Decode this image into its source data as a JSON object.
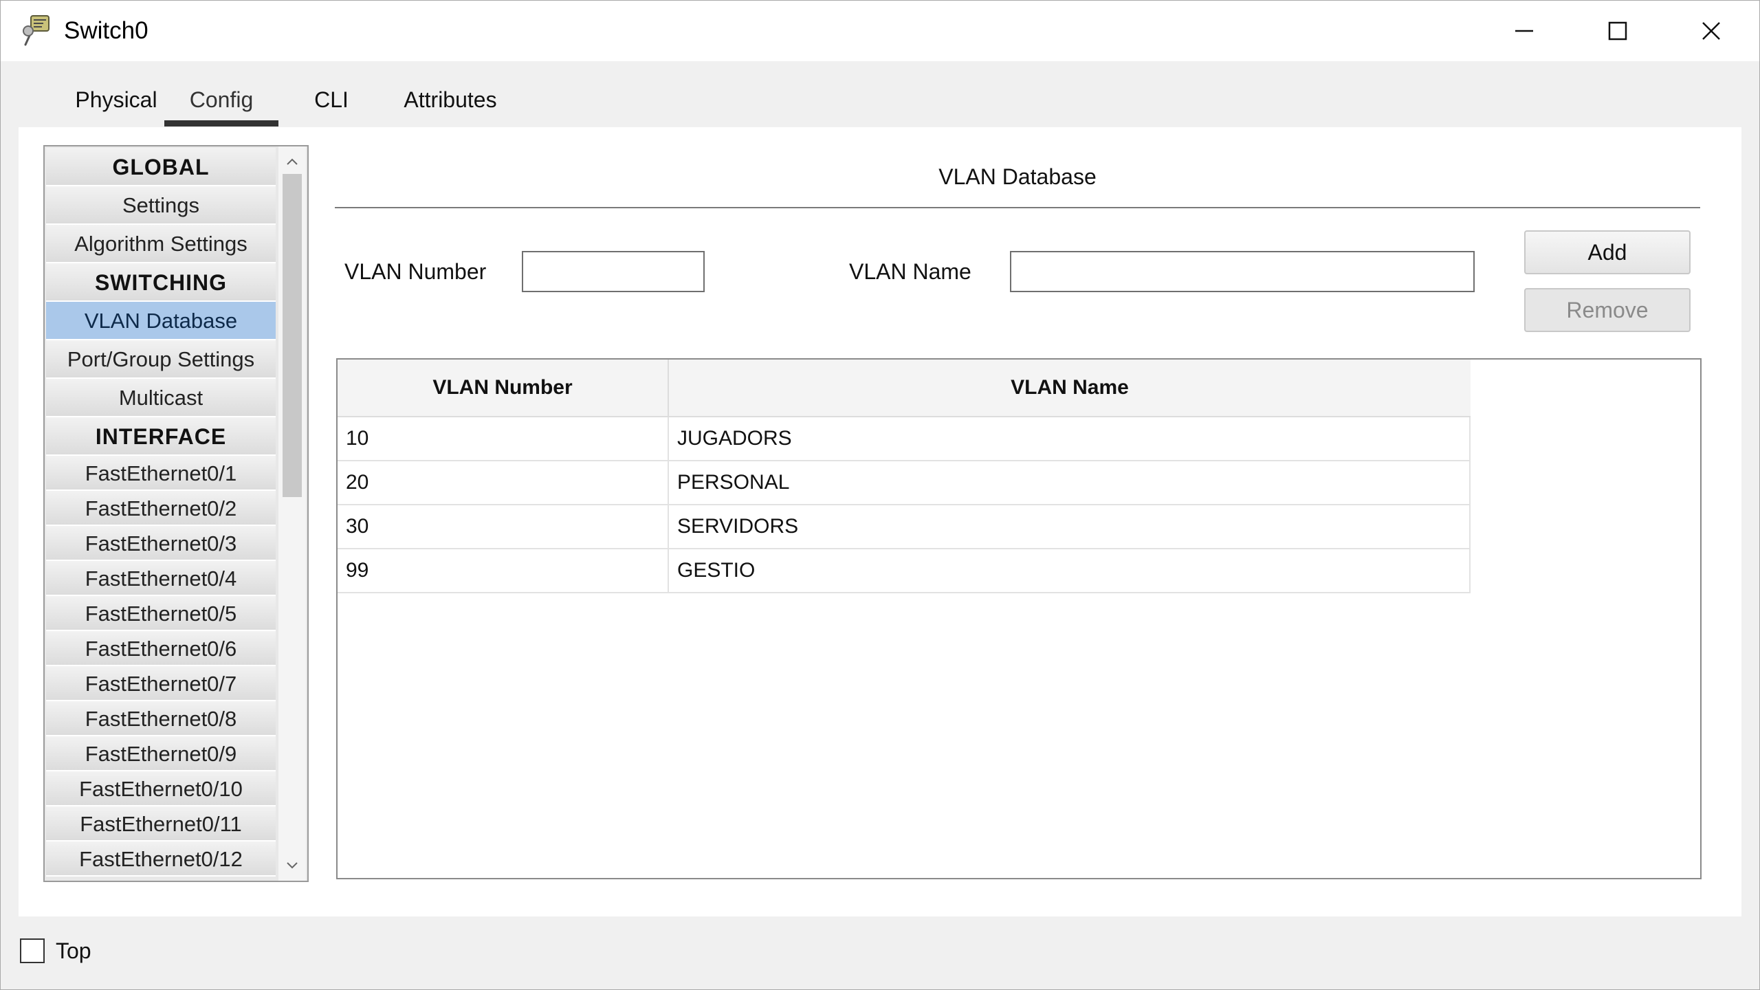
{
  "window": {
    "title": "Switch0",
    "icons": {
      "app": "switch-device-icon",
      "minimize": "minimize-icon",
      "maximize": "maximize-icon",
      "close": "close-icon"
    }
  },
  "tabs": [
    {
      "label": "Physical"
    },
    {
      "label": "Config",
      "active": true
    },
    {
      "label": "CLI"
    },
    {
      "label": "Attributes"
    }
  ],
  "nav": {
    "items": [
      {
        "label": "GLOBAL",
        "type": "header"
      },
      {
        "label": "Settings",
        "type": "item"
      },
      {
        "label": "Algorithm Settings",
        "type": "item"
      },
      {
        "label": "SWITCHING",
        "type": "header"
      },
      {
        "label": "VLAN Database",
        "type": "item",
        "selected": true
      },
      {
        "label": "Port/Group Settings",
        "type": "item"
      },
      {
        "label": "Multicast",
        "type": "item"
      },
      {
        "label": "INTERFACE",
        "type": "header"
      },
      {
        "label": "FastEthernet0/1",
        "type": "item"
      },
      {
        "label": "FastEthernet0/2",
        "type": "item"
      },
      {
        "label": "FastEthernet0/3",
        "type": "item"
      },
      {
        "label": "FastEthernet0/4",
        "type": "item"
      },
      {
        "label": "FastEthernet0/5",
        "type": "item"
      },
      {
        "label": "FastEthernet0/6",
        "type": "item"
      },
      {
        "label": "FastEthernet0/7",
        "type": "item"
      },
      {
        "label": "FastEthernet0/8",
        "type": "item"
      },
      {
        "label": "FastEthernet0/9",
        "type": "item"
      },
      {
        "label": "FastEthernet0/10",
        "type": "item"
      },
      {
        "label": "FastEthernet0/11",
        "type": "item"
      },
      {
        "label": "FastEthernet0/12",
        "type": "item"
      }
    ]
  },
  "vlan": {
    "title": "VLAN Database",
    "number_label": "VLAN Number",
    "name_label": "VLAN Name",
    "number_value": "",
    "name_value": "",
    "add_label": "Add",
    "remove_label": "Remove"
  },
  "table": {
    "columns": [
      "VLAN Number",
      "VLAN Name"
    ],
    "rows": [
      [
        "10",
        "JUGADORS"
      ],
      [
        "20",
        "PERSONAL"
      ],
      [
        "30",
        "SERVIDORS"
      ],
      [
        "99",
        "GESTIO"
      ]
    ]
  },
  "footer": {
    "top_label": "Top",
    "top_checked": false
  },
  "colors": {
    "selected_nav": "#aac8ea",
    "panel": "#ffffff",
    "chrome": "#f0f0f0"
  }
}
